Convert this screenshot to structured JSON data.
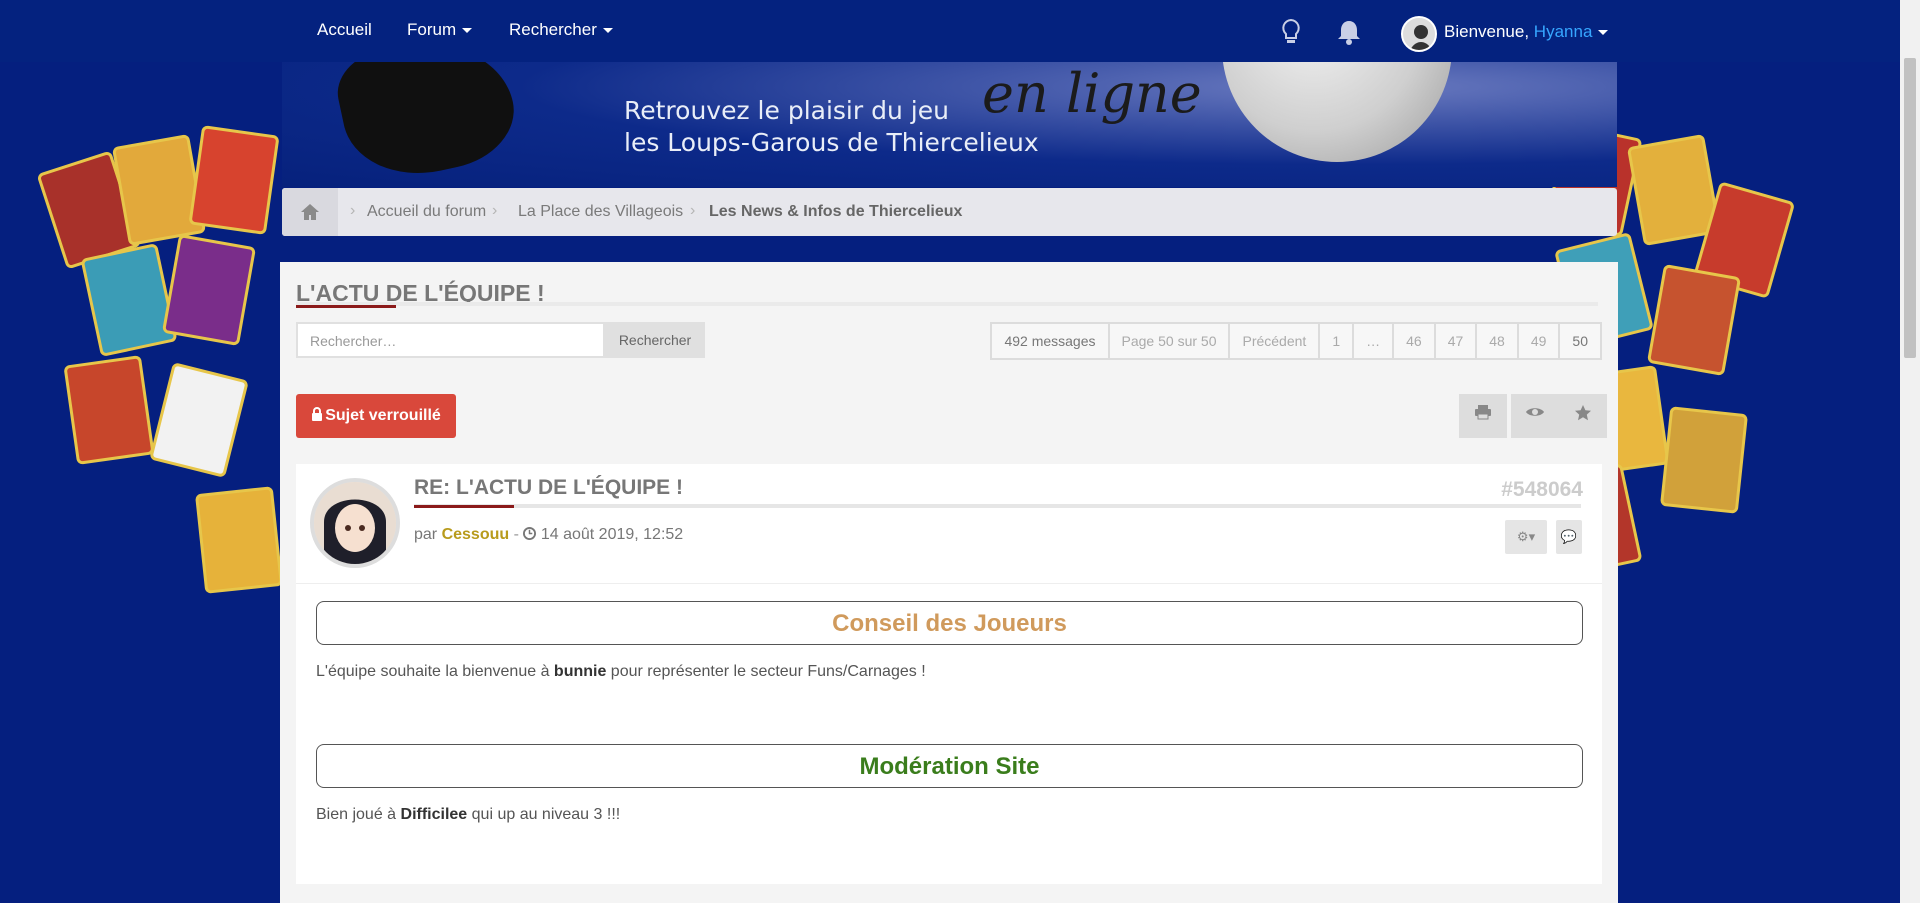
{
  "nav": {
    "home": "Accueil",
    "forum": "Forum",
    "search": "Rechercher",
    "welcome_prefix": "Bienvenue, ",
    "username": "Hyanna"
  },
  "banner": {
    "script": "en ligne",
    "line1": "Retrouvez le plaisir du jeu",
    "line2": "les Loups-Garous de Thiercelieux"
  },
  "breadcrumb": {
    "items": [
      "Accueil du forum",
      "La Place des Villageois",
      "Les News & Infos de Thiercelieux"
    ]
  },
  "topic": {
    "title": "L'ACTU DE L'ÉQUIPE !",
    "search_placeholder": "Rechercher…",
    "search_button": "Rechercher",
    "pagination": [
      "492 messages",
      "Page 50 sur 50",
      "Précédent",
      "1",
      "…",
      "46",
      "47",
      "48",
      "49",
      "50"
    ],
    "locked_label": "Sujet verrouillé"
  },
  "post": {
    "title": "RE: L'ACTU DE L'ÉQUIPE !",
    "id": "#548064",
    "by": "par ",
    "author": "Cessouu",
    "date": "14 août 2019, 12:52",
    "section1_title": "Conseil des Joueurs",
    "section1_text_a": "L'équipe souhaite la bienvenue à ",
    "section1_text_b": "bunnie",
    "section1_text_c": " pour représenter le secteur Funs/Carnages !",
    "section2_title": "Modération Site",
    "section2_text_a": "Bien joué à ",
    "section2_text_b": "Difficilee",
    "section2_text_c": " qui up au niveau 3 !!!"
  },
  "colors": {
    "background": "#051f7f",
    "section1": "#d09a5c",
    "section2": "#3a7d1c",
    "locked": "#d9483b",
    "username": "#36a6ff",
    "author": "#b89b1c"
  }
}
